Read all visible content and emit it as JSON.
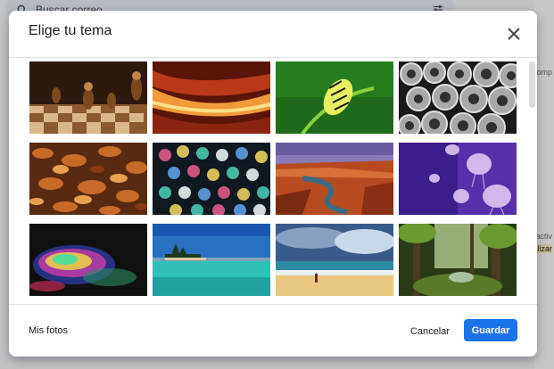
{
  "background": {
    "search_placeholder": "Buscar correo",
    "right_fragments": [
      "omp",
      "activ",
      "lizar"
    ]
  },
  "dialog": {
    "title": "Elige tu tema",
    "close_icon": "close-icon",
    "themes": [
      {
        "name": "chess",
        "colors": [
          "#2c1a0e",
          "#b07a3c"
        ]
      },
      {
        "name": "canyon-curves",
        "colors": [
          "#5a1508",
          "#e8792f"
        ]
      },
      {
        "name": "caterpillar",
        "colors": [
          "#1f6a1a",
          "#7ec23a"
        ]
      },
      {
        "name": "pipes",
        "colors": [
          "#1a1a1a",
          "#b8b8b8"
        ]
      },
      {
        "name": "autumn-leaves",
        "colors": [
          "#5a2a10",
          "#d07a30"
        ]
      },
      {
        "name": "bokeh-lights",
        "colors": [
          "#101820",
          "#48c8b0"
        ]
      },
      {
        "name": "canyon-river",
        "colors": [
          "#6a5aa0",
          "#c25a30"
        ]
      },
      {
        "name": "jellyfish",
        "colors": [
          "#3a1e8a",
          "#c8b0f0"
        ]
      },
      {
        "name": "rainbow-swirl",
        "colors": [
          "#101010",
          "#e040b0"
        ]
      },
      {
        "name": "lake-island",
        "colors": [
          "#2a70c0",
          "#30c0b8"
        ]
      },
      {
        "name": "beach",
        "colors": [
          "#3a5a8a",
          "#e8c880"
        ]
      },
      {
        "name": "forest",
        "colors": [
          "#2a3a18",
          "#8ab050"
        ]
      }
    ],
    "footer": {
      "my_photos_label": "Mis fotos",
      "cancel_label": "Cancelar",
      "save_label": "Guardar"
    }
  }
}
